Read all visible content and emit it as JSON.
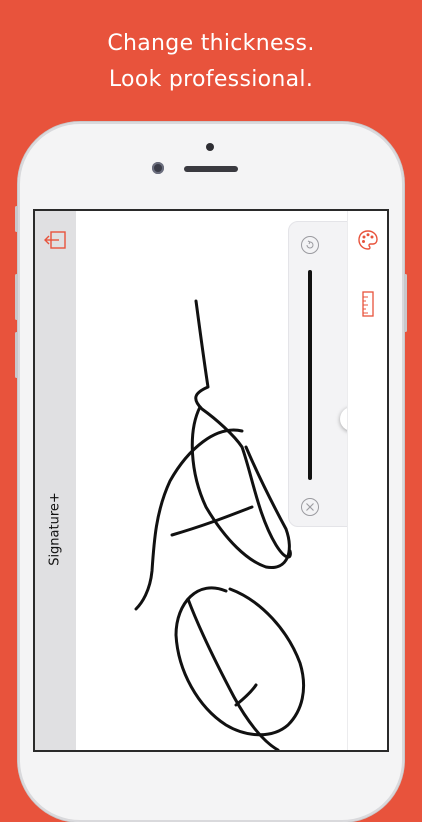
{
  "headline": {
    "line1": "Change thickness.",
    "line2": "Look professional."
  },
  "app": {
    "title": "Signature+"
  },
  "thickness": {
    "level": 0.35
  },
  "icons": {
    "exit": "exit-icon",
    "palette": "palette-icon",
    "ruler": "ruler-icon",
    "undo": "undo-icon",
    "clear": "clear-icon"
  },
  "colors": {
    "background": "#e8533c",
    "accent": "#e8533c",
    "stroke": "#111111"
  }
}
